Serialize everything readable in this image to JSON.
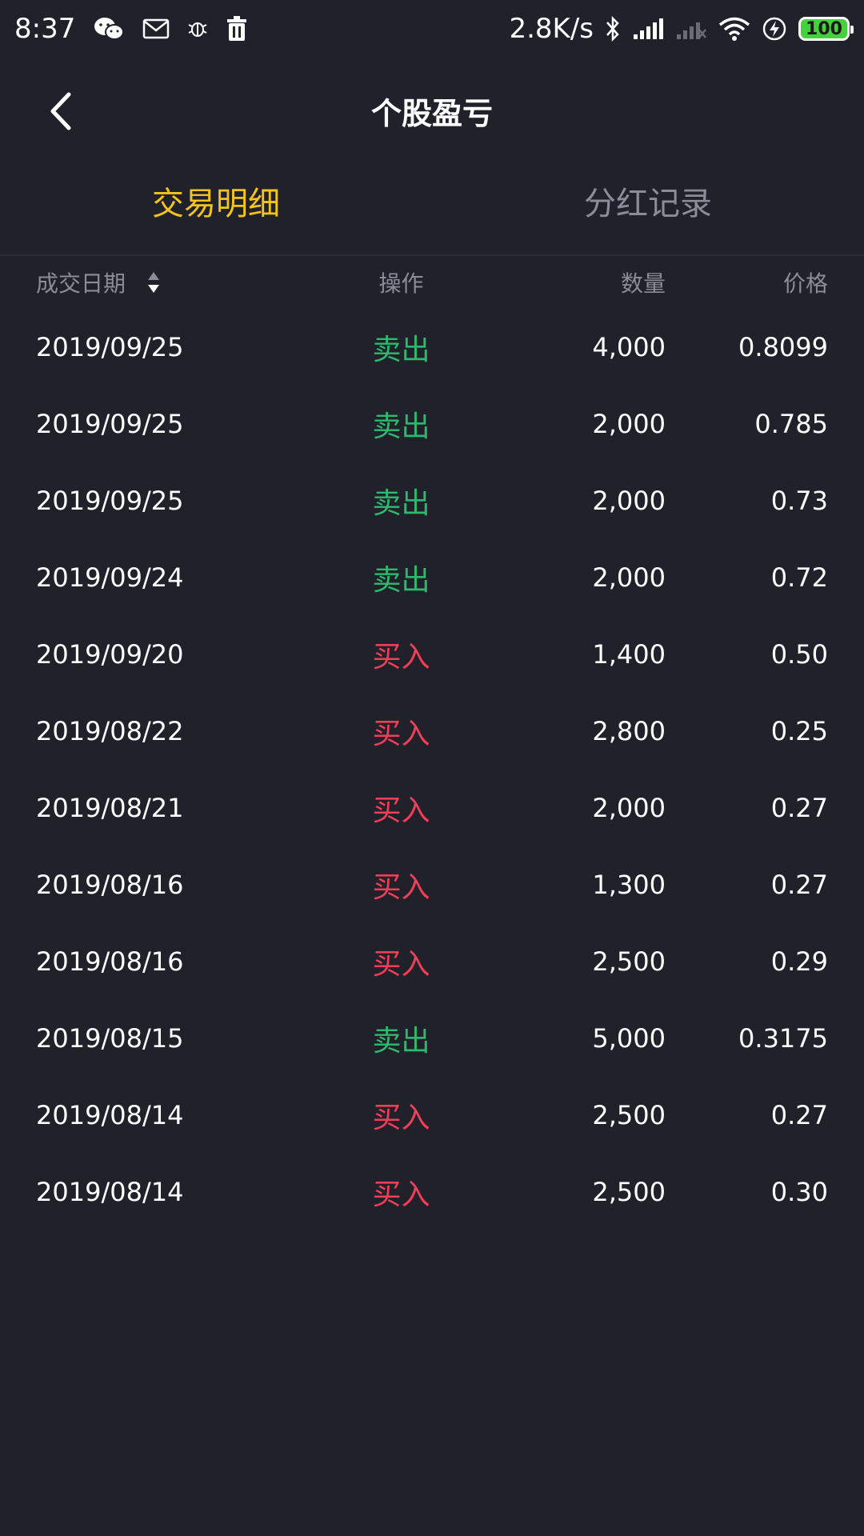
{
  "status_bar": {
    "time": "8:37",
    "network_speed": "2.8K/s",
    "battery": "100",
    "icons_left": [
      "wechat-icon",
      "mail-icon",
      "bug-icon",
      "trash-icon"
    ],
    "icons_right": [
      "bluetooth-icon",
      "signal-icon",
      "signal-weak-icon",
      "wifi-icon",
      "charging-icon",
      "battery-icon"
    ]
  },
  "header": {
    "title": "个股盈亏"
  },
  "tabs": [
    {
      "label": "交易明细",
      "active": true
    },
    {
      "label": "分红记录",
      "active": false
    }
  ],
  "table": {
    "columns": {
      "date": "成交日期",
      "operation": "操作",
      "quantity": "数量",
      "price": "价格"
    },
    "rows": [
      {
        "date": "2019/09/25",
        "operation": "卖出",
        "quantity": "4,000",
        "price": "0.8099"
      },
      {
        "date": "2019/09/25",
        "operation": "卖出",
        "quantity": "2,000",
        "price": "0.785"
      },
      {
        "date": "2019/09/25",
        "operation": "卖出",
        "quantity": "2,000",
        "price": "0.73"
      },
      {
        "date": "2019/09/24",
        "operation": "卖出",
        "quantity": "2,000",
        "price": "0.72"
      },
      {
        "date": "2019/09/20",
        "operation": "买入",
        "quantity": "1,400",
        "price": "0.50"
      },
      {
        "date": "2019/08/22",
        "operation": "买入",
        "quantity": "2,800",
        "price": "0.25"
      },
      {
        "date": "2019/08/21",
        "operation": "买入",
        "quantity": "2,000",
        "price": "0.27"
      },
      {
        "date": "2019/08/16",
        "operation": "买入",
        "quantity": "1,300",
        "price": "0.27"
      },
      {
        "date": "2019/08/16",
        "operation": "买入",
        "quantity": "2,500",
        "price": "0.29"
      },
      {
        "date": "2019/08/15",
        "operation": "卖出",
        "quantity": "5,000",
        "price": "0.3175"
      },
      {
        "date": "2019/08/14",
        "operation": "买入",
        "quantity": "2,500",
        "price": "0.27"
      },
      {
        "date": "2019/08/14",
        "operation": "买入",
        "quantity": "2,500",
        "price": "0.30"
      }
    ]
  },
  "colors": {
    "background": "#20212b",
    "active_tab": "#f4c41c",
    "muted_text": "#8a8c99",
    "sell": "#2dba6d",
    "buy": "#ef3e55",
    "battery": "#45d13b"
  }
}
